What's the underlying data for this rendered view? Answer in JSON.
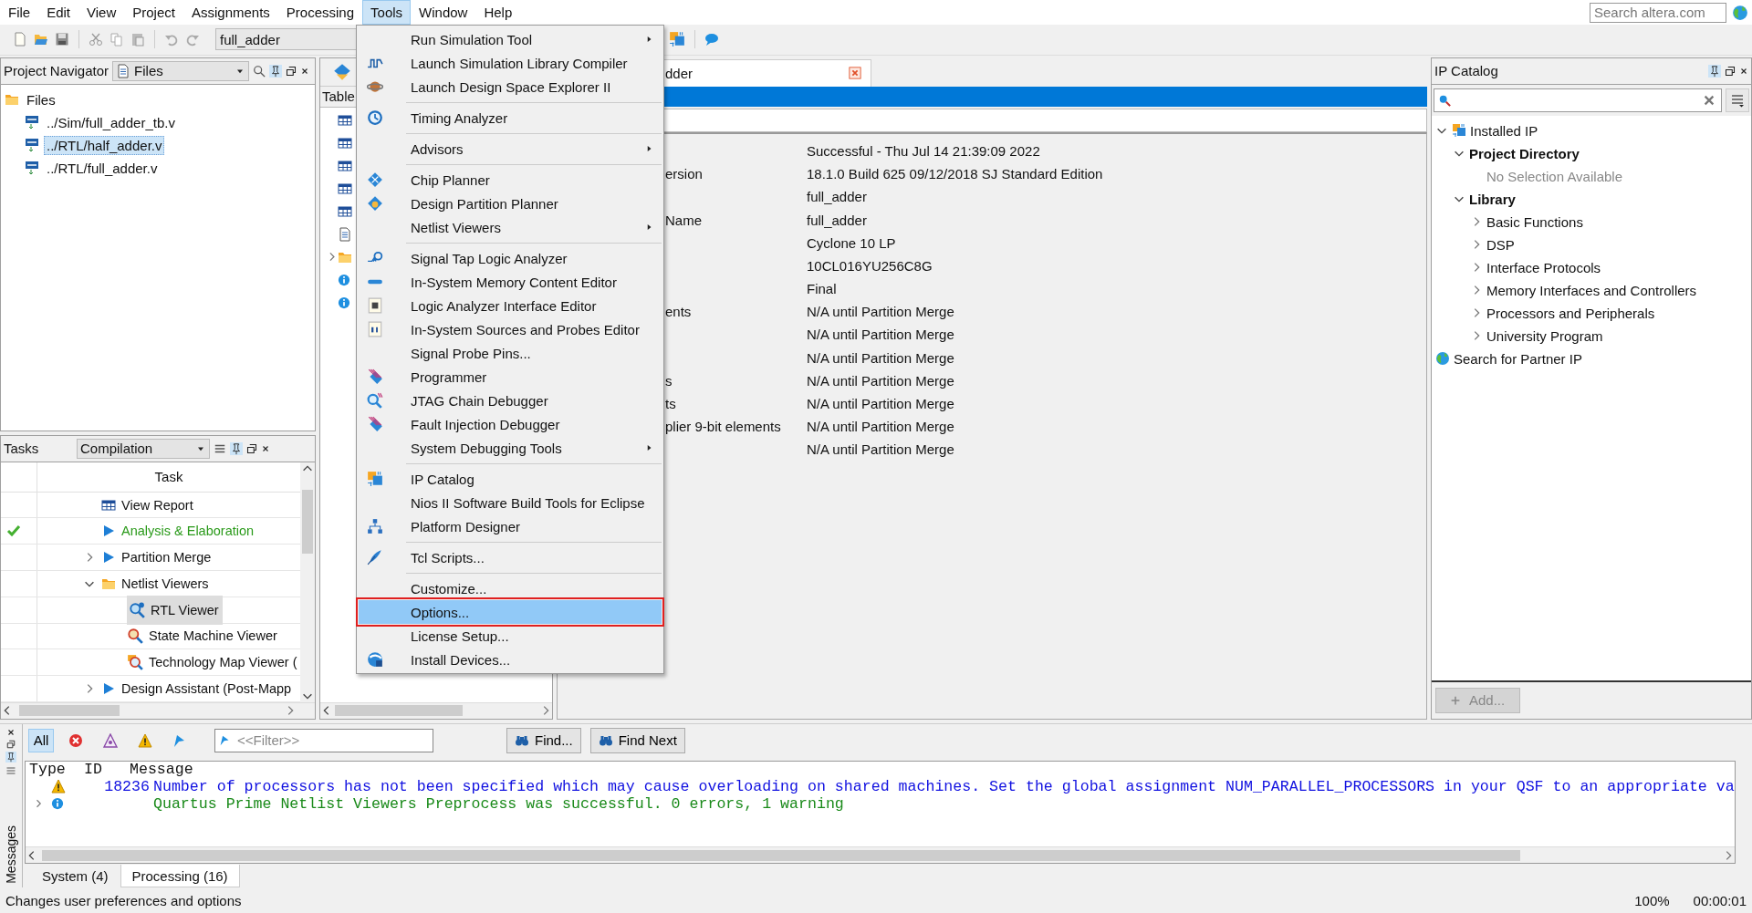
{
  "menubar": [
    {
      "label": "File",
      "selected": false
    },
    {
      "label": "Edit",
      "selected": false
    },
    {
      "label": "View",
      "selected": false
    },
    {
      "label": "Project",
      "selected": false
    },
    {
      "label": "Assignments",
      "selected": false
    },
    {
      "label": "Processing",
      "selected": false
    },
    {
      "label": "Tools",
      "selected": true
    },
    {
      "label": "Window",
      "selected": false
    },
    {
      "label": "Help",
      "selected": false
    }
  ],
  "search_field": {
    "placeholder": "Search altera.com"
  },
  "toolbar": {
    "revision": "full_adder"
  },
  "project_navigator": {
    "title": "Project Navigator",
    "view": "Files",
    "tree": [
      {
        "label": "Files",
        "selected": false,
        "children": [
          {
            "label": "../Sim/full_adder_tb.v",
            "selected": false
          },
          {
            "label": "../RTL/half_adder.v",
            "selected": true
          },
          {
            "label": "../RTL/full_adder.v",
            "selected": false
          }
        ]
      }
    ]
  },
  "tasks": {
    "title": "Tasks",
    "flow": "Compilation",
    "column": "Task",
    "rows": [
      {
        "label": "View Report",
        "kind": "report",
        "done": false,
        "selected": false
      },
      {
        "label": "Analysis & Elaboration",
        "kind": "task",
        "done": true,
        "selected": false
      },
      {
        "label": "Partition Merge",
        "kind": "task",
        "done": false,
        "expanded": false,
        "selected": false
      },
      {
        "label": "Netlist Viewers",
        "kind": "folder",
        "done": false,
        "expanded": true,
        "selected": false,
        "children": [
          {
            "label": "RTL Viewer",
            "kind": "viewer",
            "done": false,
            "selected": true
          },
          {
            "label": "State Machine Viewer",
            "kind": "viewer",
            "done": false,
            "selected": false
          },
          {
            "label": "Technology Map Viewer (",
            "kind": "viewer",
            "done": false,
            "selected": false
          }
        ]
      },
      {
        "label": "Design Assistant (Post-Mapp",
        "kind": "task",
        "done": false,
        "expanded": false,
        "selected": false
      }
    ]
  },
  "contents": {
    "header": "Table"
  },
  "tools_menu": {
    "items": [
      {
        "kind": "item",
        "label": "Run Simulation Tool",
        "submenu": true,
        "selected": false
      },
      {
        "kind": "item",
        "label": "Launch Simulation Library Compiler",
        "submenu": false,
        "selected": false
      },
      {
        "kind": "item",
        "label": "Launch Design Space Explorer II",
        "submenu": false,
        "selected": false
      },
      {
        "kind": "separator"
      },
      {
        "kind": "item",
        "label": "Timing Analyzer",
        "submenu": false,
        "selected": false
      },
      {
        "kind": "separator"
      },
      {
        "kind": "item",
        "label": "Advisors",
        "submenu": true,
        "selected": false
      },
      {
        "kind": "separator"
      },
      {
        "kind": "item",
        "label": "Chip Planner",
        "submenu": false,
        "selected": false
      },
      {
        "kind": "item",
        "label": "Design Partition Planner",
        "submenu": false,
        "selected": false
      },
      {
        "kind": "item",
        "label": "Netlist Viewers",
        "submenu": true,
        "selected": false
      },
      {
        "kind": "separator"
      },
      {
        "kind": "item",
        "label": "Signal Tap Logic Analyzer",
        "submenu": false,
        "selected": false
      },
      {
        "kind": "item",
        "label": "In-System Memory Content Editor",
        "submenu": false,
        "selected": false
      },
      {
        "kind": "item",
        "label": "Logic Analyzer Interface Editor",
        "submenu": false,
        "selected": false
      },
      {
        "kind": "item",
        "label": "In-System Sources and Probes Editor",
        "submenu": false,
        "selected": false
      },
      {
        "kind": "item",
        "label": "Signal Probe Pins...",
        "submenu": false,
        "selected": false
      },
      {
        "kind": "item",
        "label": "Programmer",
        "submenu": false,
        "selected": false
      },
      {
        "kind": "item",
        "label": "JTAG Chain Debugger",
        "submenu": false,
        "selected": false
      },
      {
        "kind": "item",
        "label": "Fault Injection Debugger",
        "submenu": false,
        "selected": false
      },
      {
        "kind": "item",
        "label": "System Debugging Tools",
        "submenu": true,
        "selected": false
      },
      {
        "kind": "separator"
      },
      {
        "kind": "item",
        "label": "IP Catalog",
        "submenu": false,
        "selected": false
      },
      {
        "kind": "item",
        "label": "Nios II Software Build Tools for Eclipse",
        "submenu": false,
        "selected": false
      },
      {
        "kind": "item",
        "label": "Platform Designer",
        "submenu": false,
        "selected": false
      },
      {
        "kind": "separator"
      },
      {
        "kind": "item",
        "label": "Tcl Scripts...",
        "submenu": false,
        "selected": false
      },
      {
        "kind": "separator"
      },
      {
        "kind": "item",
        "label": "Customize...",
        "submenu": false,
        "selected": false
      },
      {
        "kind": "item",
        "label": "Options...",
        "submenu": false,
        "selected": true
      },
      {
        "kind": "item",
        "label": "License Setup...",
        "submenu": false,
        "selected": false
      },
      {
        "kind": "item",
        "label": "Install Devices...",
        "submenu": false,
        "selected": false
      }
    ]
  },
  "report": {
    "tab": {
      "label": "dder",
      "selected": true
    },
    "rows": [
      {
        "value": "Successful - Thu Jul 14 21:39:09 2022"
      },
      {
        "label": "ersion",
        "value": "18.1.0 Build 625 09/12/2018 SJ Standard Edition"
      },
      {
        "value": "full_adder"
      },
      {
        "label": "Name",
        "value": "full_adder"
      },
      {
        "value": "Cyclone 10 LP"
      },
      {
        "value": "10CL016YU256C8G"
      },
      {
        "value": "Final"
      },
      {
        "label": "ents",
        "value": "N/A until Partition Merge"
      },
      {
        "value": "N/A until Partition Merge"
      },
      {
        "value": "N/A until Partition Merge"
      },
      {
        "label": "s",
        "value": "N/A until Partition Merge"
      },
      {
        "label": "ts",
        "value": "N/A until Partition Merge"
      },
      {
        "label": "plier 9-bit elements",
        "value": "N/A until Partition Merge"
      },
      {
        "value": "N/A until Partition Merge"
      }
    ]
  },
  "ip_catalog": {
    "title": "IP Catalog",
    "tree": [
      {
        "label": "Installed IP",
        "kind": "root",
        "expanded": true,
        "children": [
          {
            "label": "Project Directory",
            "kind": "group",
            "expanded": true,
            "children": [
              {
                "label": "No Selection Available",
                "kind": "empty"
              }
            ]
          },
          {
            "label": "Library",
            "kind": "group",
            "expanded": true,
            "children": [
              {
                "label": "Basic Functions",
                "kind": "category",
                "expanded": false
              },
              {
                "label": "DSP",
                "kind": "category",
                "expanded": false
              },
              {
                "label": "Interface Protocols",
                "kind": "category",
                "expanded": false
              },
              {
                "label": "Memory Interfaces and Controllers",
                "kind": "category",
                "expanded": false
              },
              {
                "label": "Processors and Peripherals",
                "kind": "category",
                "expanded": false
              },
              {
                "label": "University Program",
                "kind": "category",
                "expanded": false
              }
            ]
          }
        ]
      },
      {
        "label": "Search for Partner IP",
        "kind": "link"
      }
    ],
    "add_button": {
      "label": "Add...",
      "disabled": true
    }
  },
  "messages": {
    "title": "Messages",
    "filters": [
      {
        "kind": "all",
        "label": "All",
        "selected": true
      },
      {
        "kind": "error",
        "selected": false
      },
      {
        "kind": "critical",
        "selected": false
      },
      {
        "kind": "warning",
        "selected": false
      },
      {
        "kind": "flag",
        "selected": false
      }
    ],
    "filter_field": {
      "placeholder": "<<Filter>>"
    },
    "find_buttons": [
      "Find...",
      "Find Next"
    ],
    "columns": [
      "Type",
      "ID",
      "Message"
    ],
    "rows": [
      {
        "kind": "warning",
        "id": "18236",
        "text": "Number of processors has not been specified which may cause overloading on shared machines.  Set the global assignment NUM_PARALLEL_PROCESSORS in your QSF to an appropriate va"
      },
      {
        "kind": "info",
        "expanded": false,
        "text": "Quartus Prime Netlist Viewers Preprocess was successful. 0 errors, 1 warning"
      }
    ],
    "tabs": [
      {
        "label": "System (4)",
        "selected": false
      },
      {
        "label": "Processing (16)",
        "selected": true
      }
    ]
  },
  "status_bar": {
    "text": "Changes user preferences and options",
    "zoom": "100%",
    "time": "00:00:01"
  }
}
